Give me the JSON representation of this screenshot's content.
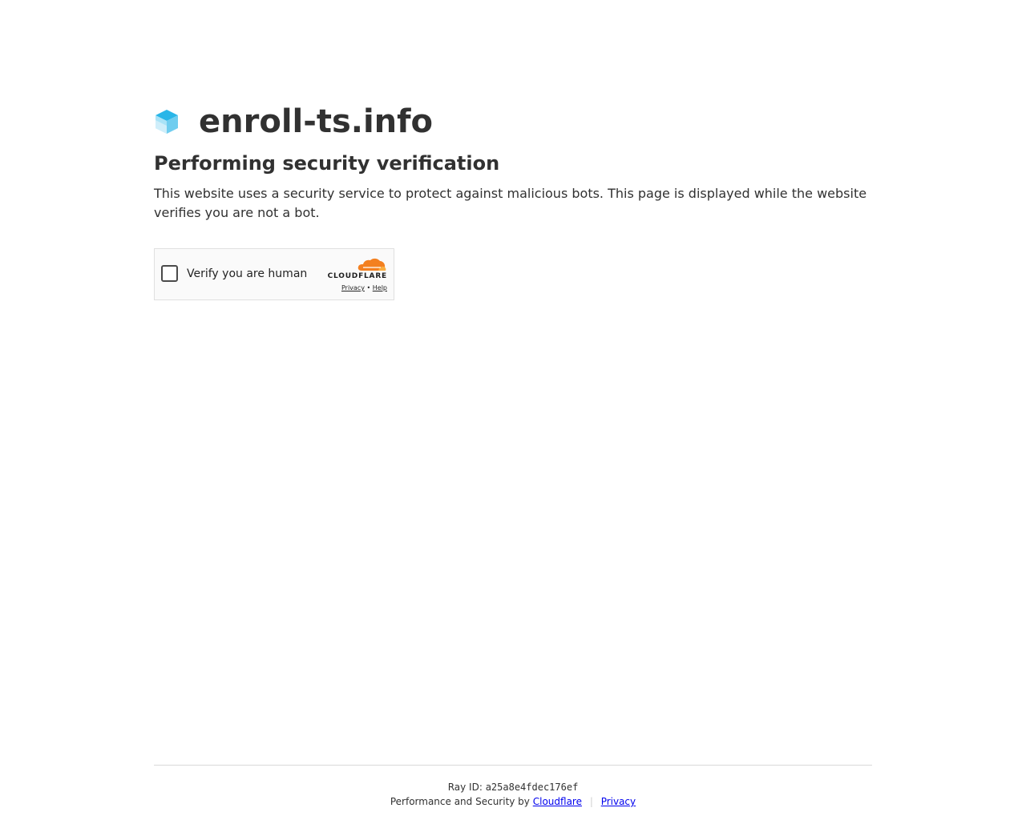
{
  "site": {
    "name": "enroll-ts.info"
  },
  "verification": {
    "heading": "Performing security verification",
    "description": "This website uses a security service to protect against malicious bots. This page is displayed while the website verifies you are not a bot."
  },
  "widget": {
    "checkbox_label": "Verify you are human",
    "brand": "CLOUDFLARE",
    "privacy_link": "Privacy",
    "links_separator": "•",
    "help_link": "Help",
    "checked": false
  },
  "footer": {
    "ray_label": "Ray ID:",
    "ray_id": "a25a8e4fdec176ef",
    "performance_text": "Performance and Security by",
    "cloudflare_link": "Cloudflare",
    "separator": "|",
    "privacy_link": "Privacy"
  },
  "colors": {
    "text": "#313131",
    "link": "#0000ee",
    "cloud_orange": "#f38020",
    "cloud_light_orange": "#faae40",
    "logo_blue": "#29b6e8"
  }
}
